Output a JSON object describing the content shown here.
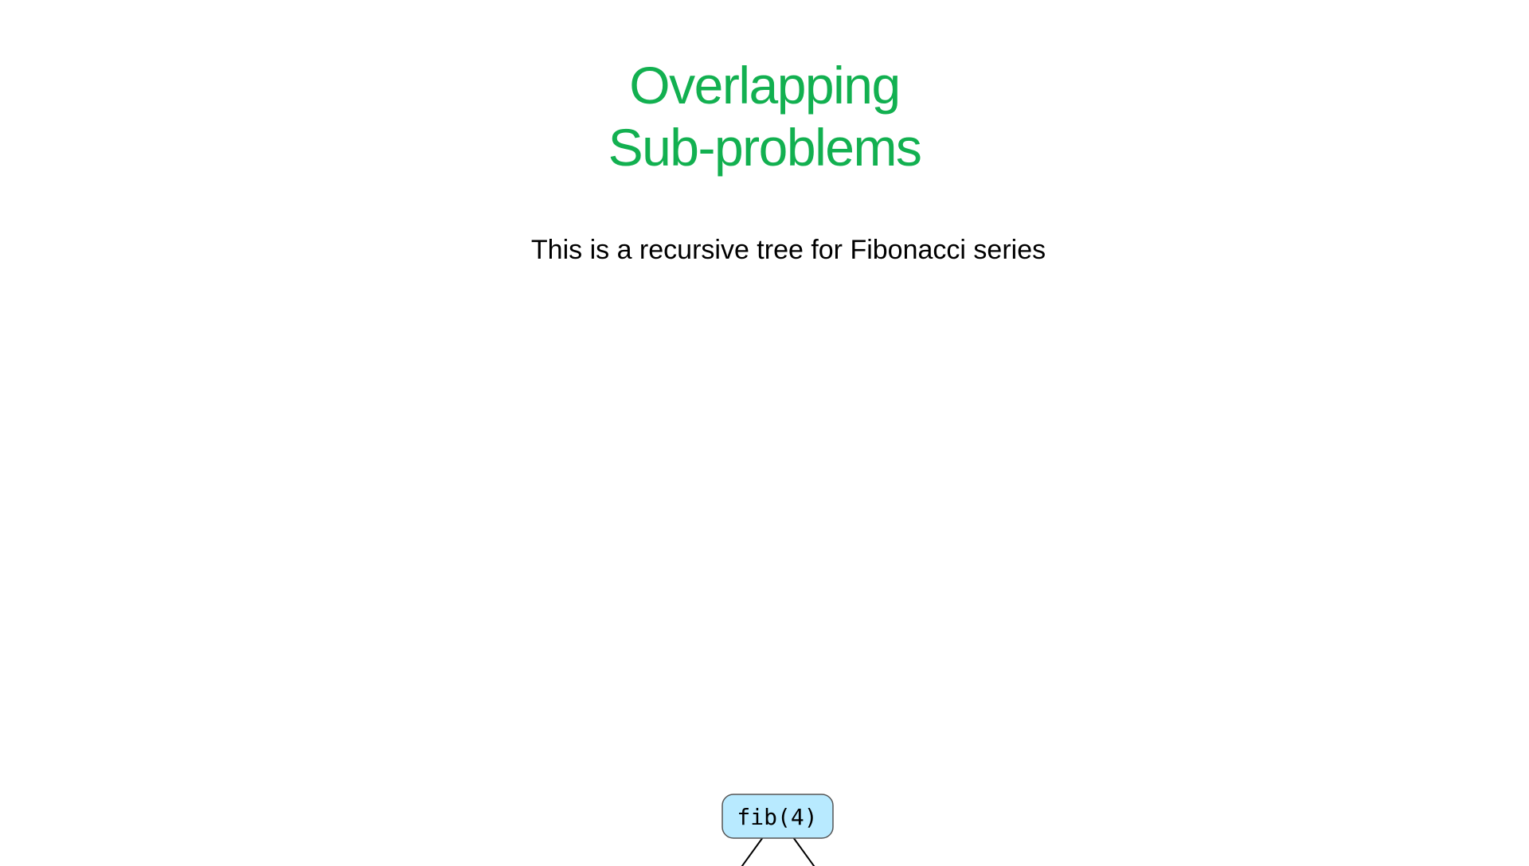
{
  "slide": {
    "title_line1": "Overlapping",
    "title_line2": "Sub-problems",
    "subtitle": "This is a recursive tree for Fibonacci series"
  },
  "tree": {
    "nodes": [
      {
        "id": "root",
        "label": "fib(4)"
      }
    ],
    "colors": {
      "node_fill": "#b8eaff",
      "node_stroke": "#555555",
      "edge": "#000000",
      "title": "#12b050"
    }
  }
}
